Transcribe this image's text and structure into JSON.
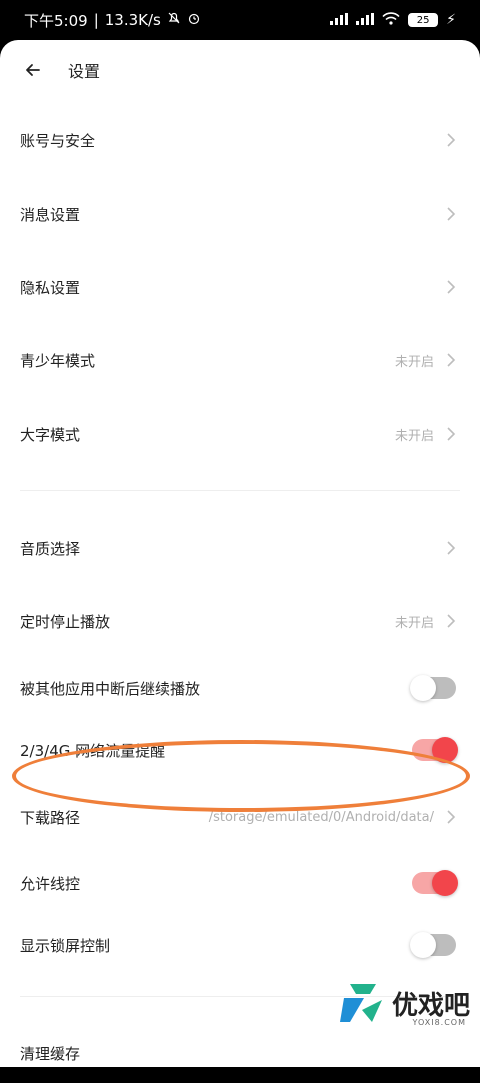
{
  "status": {
    "time": "下午5:09",
    "speed": "13.3K/s",
    "battery": "25"
  },
  "header": {
    "title": "设置"
  },
  "rows": [
    {
      "label": "账号与安全",
      "value": "",
      "type": "link"
    },
    {
      "label": "消息设置",
      "value": "",
      "type": "link"
    },
    {
      "label": "隐私设置",
      "value": "",
      "type": "link"
    },
    {
      "label": "青少年模式",
      "value": "未开启",
      "type": "link"
    },
    {
      "label": "大字模式",
      "value": "未开启",
      "type": "link"
    },
    {
      "label": "音质选择",
      "value": "",
      "type": "link"
    },
    {
      "label": "定时停止播放",
      "value": "未开启",
      "type": "link"
    },
    {
      "label": "被其他应用中断后继续播放",
      "value": "",
      "type": "toggle",
      "on": false
    },
    {
      "label": "2/3/4G 网络流量提醒",
      "value": "",
      "type": "toggle",
      "on": true
    },
    {
      "label": "下载路径",
      "value": "/storage/emulated/0/Android/data/",
      "type": "link"
    },
    {
      "label": "允许线控",
      "value": "",
      "type": "toggle",
      "on": true
    },
    {
      "label": "显示锁屏控制",
      "value": "",
      "type": "toggle",
      "on": false
    },
    {
      "label": "清理缓存",
      "value": "",
      "type": "link"
    }
  ],
  "watermark": {
    "text": "优戏吧",
    "sub": "YOXI8.COM"
  },
  "colors": {
    "accent": "#f2454b",
    "highlight": "#ef7f3a"
  }
}
